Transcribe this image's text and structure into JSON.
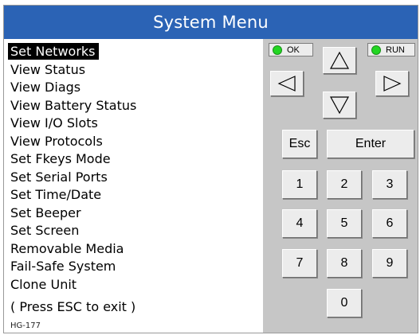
{
  "title": "System Menu",
  "menu": {
    "items": [
      {
        "label": "Set Networks",
        "selected": true
      },
      {
        "label": "View Status"
      },
      {
        "label": "View Diags"
      },
      {
        "label": "View Battery Status"
      },
      {
        "label": "View I/O Slots"
      },
      {
        "label": "View Protocols"
      },
      {
        "label": "Set Fkeys Mode"
      },
      {
        "label": "Set Serial Ports"
      },
      {
        "label": "Set Time/Date"
      },
      {
        "label": "Set Beeper"
      },
      {
        "label": "Set Screen"
      },
      {
        "label": "Removable Media"
      },
      {
        "label": "Fail-Safe System"
      },
      {
        "label": "Clone Unit"
      }
    ]
  },
  "hint": "( Press ESC to exit )",
  "model": "HG-177",
  "indicators": {
    "ok": "OK",
    "run": "RUN",
    "led_color": "#22d622"
  },
  "keys": {
    "up_icon": "up-arrow-icon",
    "down_icon": "down-arrow-icon",
    "left_icon": "left-arrow-icon",
    "right_icon": "right-arrow-icon",
    "esc": "Esc",
    "enter": "Enter",
    "k1": "1",
    "k2": "2",
    "k3": "3",
    "k4": "4",
    "k5": "5",
    "k6": "6",
    "k7": "7",
    "k8": "8",
    "k9": "9",
    "k0": "0"
  },
  "colors": {
    "title_bar": "#2b63b5",
    "keypad_bg": "#c6c6c6",
    "selection": "#000000"
  }
}
